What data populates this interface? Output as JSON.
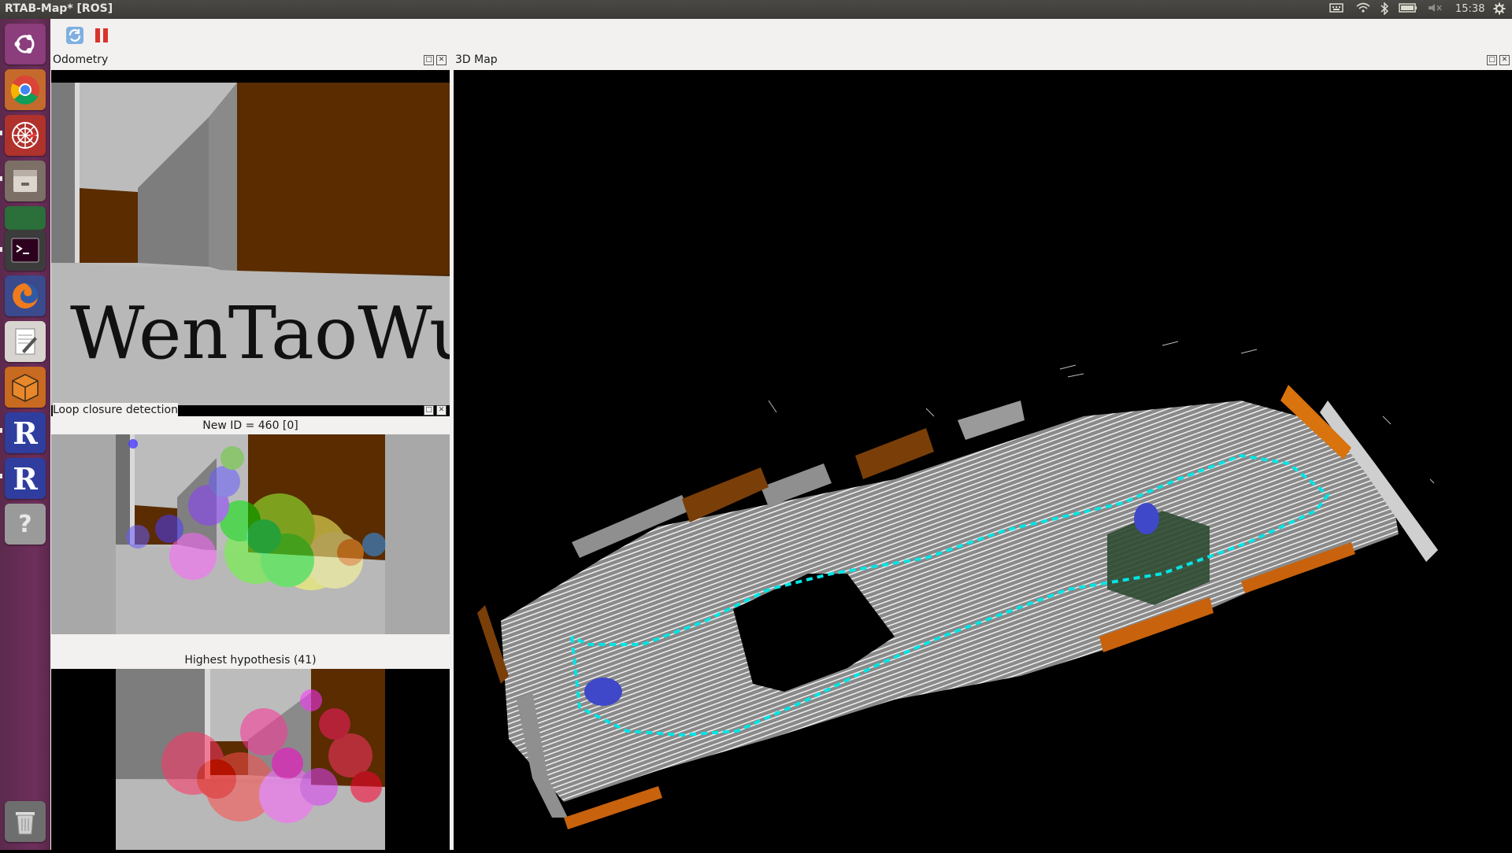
{
  "window": {
    "title": "RTAB-Map* [ROS]"
  },
  "tray": {
    "time": "15:38"
  },
  "launcher": {
    "items": [
      {
        "name": "ubuntu-dash-icon"
      },
      {
        "name": "chrome-icon"
      },
      {
        "name": "rviz-icon"
      },
      {
        "name": "files-icon"
      },
      {
        "name": "app-icon"
      },
      {
        "name": "terminal-icon"
      },
      {
        "name": "firefox-icon"
      },
      {
        "name": "text-editor-icon"
      },
      {
        "name": "box-icon"
      },
      {
        "name": "r-app-icon"
      },
      {
        "name": "r-app-icon"
      },
      {
        "name": "help-icon"
      },
      {
        "name": "trash-icon"
      }
    ]
  },
  "toolbar": {
    "refresh_tooltip": "",
    "pause_tooltip": ""
  },
  "docks": {
    "odometry": {
      "title": "Odometry"
    },
    "map3d": {
      "title": "3D Map"
    },
    "loop": {
      "title": "Loop closure detection",
      "new_id_caption": "New ID = 460 [0]",
      "hypothesis_caption": "Highest hypothesis (41)"
    }
  },
  "odometry_view": {
    "watermark": "WenTaoWu"
  },
  "colors": {
    "panel_bg": "#f2f1f0",
    "launcher": "#6e2f5c",
    "wall_brown": "#5a2c00",
    "wall_gray": "#8a8a8a",
    "floor_gray": "#b5b5b5",
    "trajectory": "#00e5e5",
    "bench_orange": "#d9730d"
  }
}
